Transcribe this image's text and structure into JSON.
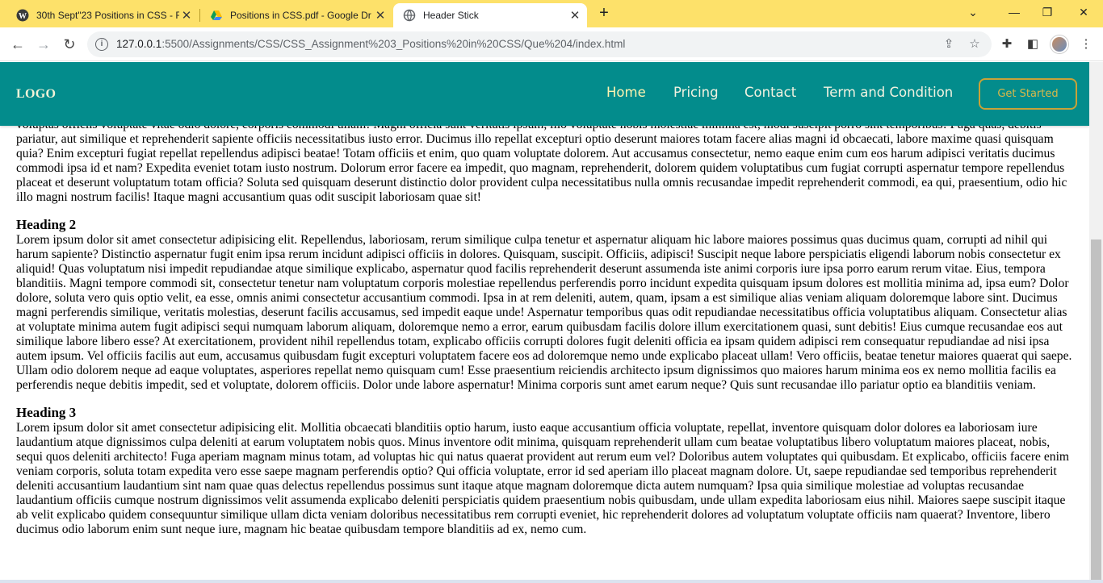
{
  "browser": {
    "tabs": [
      {
        "title": "30th Sept\"23 Positions in CSS - F",
        "icon": "wordpress-icon"
      },
      {
        "title": "Positions in CSS.pdf - Google Dr",
        "icon": "google-drive-icon"
      },
      {
        "title": "Header Stick",
        "icon": "globe-icon"
      }
    ],
    "new_tab": "+",
    "url_host": "127.0.0.1",
    "url_path": ":5500/Assignments/CSS/CSS_Assignment%203_Positions%20in%20CSS/Que%204/index.html",
    "colors": {
      "tabbar": "#fde16a"
    }
  },
  "header": {
    "logo": "LOGO",
    "nav": [
      "Home",
      "Pricing",
      "Contact",
      "Term and Condition"
    ],
    "cta": "Get Started",
    "colors": {
      "background": "#038c8c",
      "cta_border": "#c9a238"
    }
  },
  "content": {
    "intro_partial": "voluptas officiis voluptate vitae odio dolore, corporis commodi ullam! Magni officia sunt veritatis ipsum, illo voluptate nobis molestiae minima est, modi suscipit porro sint temporibus! Fuga quas, debitis pariatur, aut similique et reprehenderit sapiente officiis necessitatibus iusto error. Ducimus illo repellat excepturi optio deserunt maiores totam facere alias magni id obcaecati, labore maxime quasi quisquam quia? Enim excepturi fugiat repellat repellendus adipisci beatae! Totam officiis et enim, quo quam voluptate dolorem. Aut accusamus consectetur, nemo eaque enim cum eos harum adipisci veritatis ducimus commodi ipsa id et nam? Expedita eveniet totam iusto nostrum. Dolorum error facere ea impedit, quo magnam, reprehenderit, dolorem quidem voluptatibus cum fugiat corrupti aspernatur tempore repellendus placeat et deserunt voluptatum totam officia? Soluta sed quisquam deserunt distinctio dolor provident culpa necessitatibus nulla omnis recusandae impedit reprehenderit commodi, ea qui, praesentium, odio hic illo magni nostrum facilis! Itaque magni accusantium quas odit suscipit laboriosam quae sit!",
    "heading2": "Heading 2",
    "para2": "Lorem ipsum dolor sit amet consectetur adipisicing elit. Repellendus, laboriosam, rerum similique culpa tenetur et aspernatur aliquam hic labore maiores possimus quas ducimus quam, corrupti ad nihil qui harum sapiente? Distinctio aspernatur fugit enim ipsa rerum incidunt adipisci officiis in dolores. Quisquam, suscipit. Officiis, adipisci! Suscipit neque labore perspiciatis eligendi laborum nobis consectetur ex aliquid! Quas voluptatum nisi impedit repudiandae atque similique explicabo, aspernatur quod facilis reprehenderit deserunt assumenda iste animi corporis iure ipsa porro earum rerum vitae. Eius, tempora blanditiis. Magni tempore commodi sit, consectetur tenetur nam voluptatum corporis molestiae repellendus perferendis porro incidunt expedita quisquam ipsum dolores est mollitia minima ad, ipsa eum? Dolor dolore, soluta vero quis optio velit, ea esse, omnis animi consectetur accusantium commodi. Ipsa in at rem deleniti, autem, quam, ipsam a est similique alias veniam aliquam doloremque labore sint. Ducimus magni perferendis similique, veritatis molestias, deserunt facilis accusamus, sed impedit eaque unde! Aspernatur temporibus quas odit repudiandae necessitatibus officia voluptatibus aliquam. Consectetur alias at voluptate minima autem fugit adipisci sequi numquam laborum aliquam, doloremque nemo a error, earum quibusdam facilis dolore illum exercitationem quasi, sunt debitis! Eius cumque recusandae eos aut similique labore libero esse? At exercitationem, provident nihil repellendus totam, explicabo officiis corrupti dolores fugit deleniti officia ea ipsam quidem adipisci rem consequatur repudiandae ad nisi ipsa autem ipsum. Vel officiis facilis aut eum, accusamus quibusdam fugit excepturi voluptatem facere eos ad doloremque nemo unde explicabo placeat ullam! Vero officiis, beatae tenetur maiores quaerat qui saepe. Ullam odio dolorem neque ad eaque voluptates, asperiores repellat nemo quisquam cum! Esse praesentium reiciendis architecto ipsum dignissimos quo maiores harum minima eos ex nemo mollitia facilis ea perferendis neque debitis impedit, sed et voluptate, dolorem officiis. Dolor unde labore aspernatur! Minima corporis sunt amet earum neque? Quis sunt recusandae illo pariatur optio ea blanditiis veniam.",
    "heading3": "Heading 3",
    "para3": "Lorem ipsum dolor sit amet consectetur adipisicing elit. Mollitia obcaecati blanditiis optio harum, iusto eaque accusantium officia voluptate, repellat, inventore quisquam dolor dolores ea laboriosam iure laudantium atque dignissimos culpa deleniti at earum voluptatem nobis quos. Minus inventore odit minima, quisquam reprehenderit ullam cum beatae voluptatibus libero voluptatum maiores placeat, nobis, sequi quos deleniti architecto! Fuga aperiam magnam minus totam, ad voluptas hic qui natus quaerat provident aut rerum eum vel? Doloribus autem voluptates qui quibusdam. Et explicabo, officiis facere enim veniam corporis, soluta totam expedita vero esse saepe magnam perferendis optio? Qui officia voluptate, error id sed aperiam illo placeat magnam dolore. Ut, saepe repudiandae sed temporibus reprehenderit deleniti accusantium laudantium sint nam quae quas delectus repellendus possimus sunt itaque atque magnam doloremque dicta autem numquam? Ipsa quia similique molestiae ad voluptas recusandae laudantium officiis cumque nostrum dignissimos velit assumenda explicabo deleniti perspiciatis quidem praesentium nobis quibusdam, unde ullam expedita laboriosam eius nihil. Maiores saepe suscipit itaque ab velit explicabo quidem consequuntur similique ullam dicta veniam doloribus necessitatibus rem corrupti eveniet, hic reprehenderit dolores ad voluptatum voluptate officiis nam quaerat? Inventore, libero ducimus odio laborum enim sunt neque iure, magnam hic beatae quibusdam tempore blanditiis ad ex, nemo cum."
  }
}
